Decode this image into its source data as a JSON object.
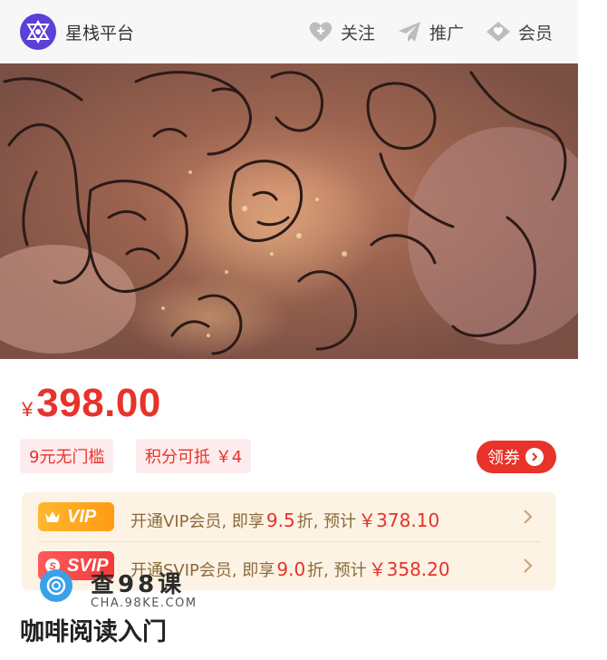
{
  "header": {
    "brand": "星栈平台",
    "nav": [
      {
        "label": "关注",
        "icon": "heart-plus-icon"
      },
      {
        "label": "推广",
        "icon": "paper-plane-icon"
      },
      {
        "label": "会员",
        "icon": "diamond-heart-icon"
      }
    ]
  },
  "banner": {
    "alt": "banner-illustration"
  },
  "price": {
    "symbol": "¥",
    "value": "398.00"
  },
  "tags": [
    {
      "label": "9元无门槛"
    },
    {
      "label": "积分可抵 ￥4"
    }
  ],
  "coupon": {
    "label": "领券"
  },
  "vip": {
    "rows": [
      {
        "badge": "VIP",
        "prefix": "开通VIP会员, 即享",
        "discount": "9.5",
        "mid": "折, 预计",
        "price": "￥378.10"
      },
      {
        "badge": "SVIP",
        "prefix": "开通SVIP会员, 即享",
        "discount": "9.0",
        "mid": "折, 预计",
        "price": "￥358.20"
      }
    ]
  },
  "watermark": {
    "title": "查98课",
    "sub": "CHA.98KE.COM"
  },
  "course": {
    "title": "咖啡阅读入门"
  },
  "colors": {
    "accent": "#e8322a",
    "brand": "#5b3fd6",
    "vip": "#ffa41c",
    "svip": "#f23a3a"
  }
}
